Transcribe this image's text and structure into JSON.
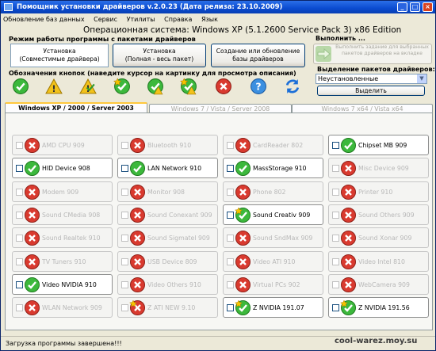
{
  "window": {
    "title": "Помощник установки драйверов v.2.0.23 (Дата релиза: 23.10.2009)"
  },
  "menu": [
    "Обновление баз данных",
    "Сервис",
    "Утилиты",
    "Справка",
    "Язык"
  ],
  "os": "Операционная система: Windows XP  (5.1.2600 Service Pack 3) x86 Edition",
  "modes": {
    "label": "Режим работы программы с пакетами драйверов",
    "install_compat": [
      "Установка",
      "(Совместимые драйвера)"
    ],
    "install_full": [
      "Установка",
      "(Полная - весь пакет)"
    ],
    "create": [
      "Создание или обновление",
      "базы драйверов"
    ]
  },
  "legend": {
    "label": "Обозначения кнопок (наведите курсор на картинку для просмотра описания)",
    "icons": [
      "check",
      "warn",
      "warn-check",
      "check-star",
      "check-warn",
      "check-warn2",
      "cross",
      "help",
      "refresh"
    ]
  },
  "run": {
    "label": "Выполнить ...",
    "text": "Выполнить задание для выбранных пакетов драйверов на вкладке"
  },
  "select": {
    "label": "Выделение пакетов драйверов:",
    "value": "Неустановленные",
    "button": "Выделить"
  },
  "tabs": [
    "Windows XP / 2000 / Server 2003",
    "Windows 7 / Vista / Server 2008",
    "Windows 7 x64 / Vista x64"
  ],
  "drivers": [
    {
      "name": "AMD CPU 909",
      "s": "x"
    },
    {
      "name": "Bluetooth 910",
      "s": "x"
    },
    {
      "name": "CardReader 802",
      "s": "x"
    },
    {
      "name": "Chipset MB 909",
      "s": "v",
      "on": true
    },
    {
      "name": "HID Device 908",
      "s": "v",
      "on": true
    },
    {
      "name": "LAN Network 910",
      "s": "v",
      "on": true
    },
    {
      "name": "MassStorage 910",
      "s": "v",
      "on": true
    },
    {
      "name": "Misc Device 909",
      "s": "x"
    },
    {
      "name": "Modem 909",
      "s": "x"
    },
    {
      "name": "Monitor 908",
      "s": "x"
    },
    {
      "name": "Phone 802",
      "s": "x"
    },
    {
      "name": "Printer 910",
      "s": "x"
    },
    {
      "name": "Sound CMedia 908",
      "s": "x"
    },
    {
      "name": "Sound Conexant 909",
      "s": "x"
    },
    {
      "name": "Sound Creativ 909",
      "s": "vs",
      "on": true
    },
    {
      "name": "Sound Others 909",
      "s": "x"
    },
    {
      "name": "Sound Realtek 910",
      "s": "x"
    },
    {
      "name": "Sound Sigmatel 909",
      "s": "x"
    },
    {
      "name": "Sound SndMax 909",
      "s": "x"
    },
    {
      "name": "Sound Xonar 909",
      "s": "x"
    },
    {
      "name": "TV Tuners 910",
      "s": "x"
    },
    {
      "name": "USB Device 809",
      "s": "x"
    },
    {
      "name": "Video ATI 910",
      "s": "x"
    },
    {
      "name": "Video Intel 810",
      "s": "x"
    },
    {
      "name": "Video NVIDIA 910",
      "s": "v",
      "on": true
    },
    {
      "name": "Video Others 910",
      "s": "x"
    },
    {
      "name": "Virtual PCs 902",
      "s": "x"
    },
    {
      "name": "WebCamera 909",
      "s": "x"
    },
    {
      "name": "WLAN Network 909",
      "s": "x"
    },
    {
      "name": "Z ATI NEW 9.10",
      "s": "xs"
    },
    {
      "name": "Z NVIDIA 191.07",
      "s": "vs",
      "on": true
    },
    {
      "name": "Z NVIDIA 191.56",
      "s": "vs",
      "on": true
    }
  ],
  "status": "Загрузка программы завершена!!!",
  "watermark": "cool-warez.moy.su"
}
